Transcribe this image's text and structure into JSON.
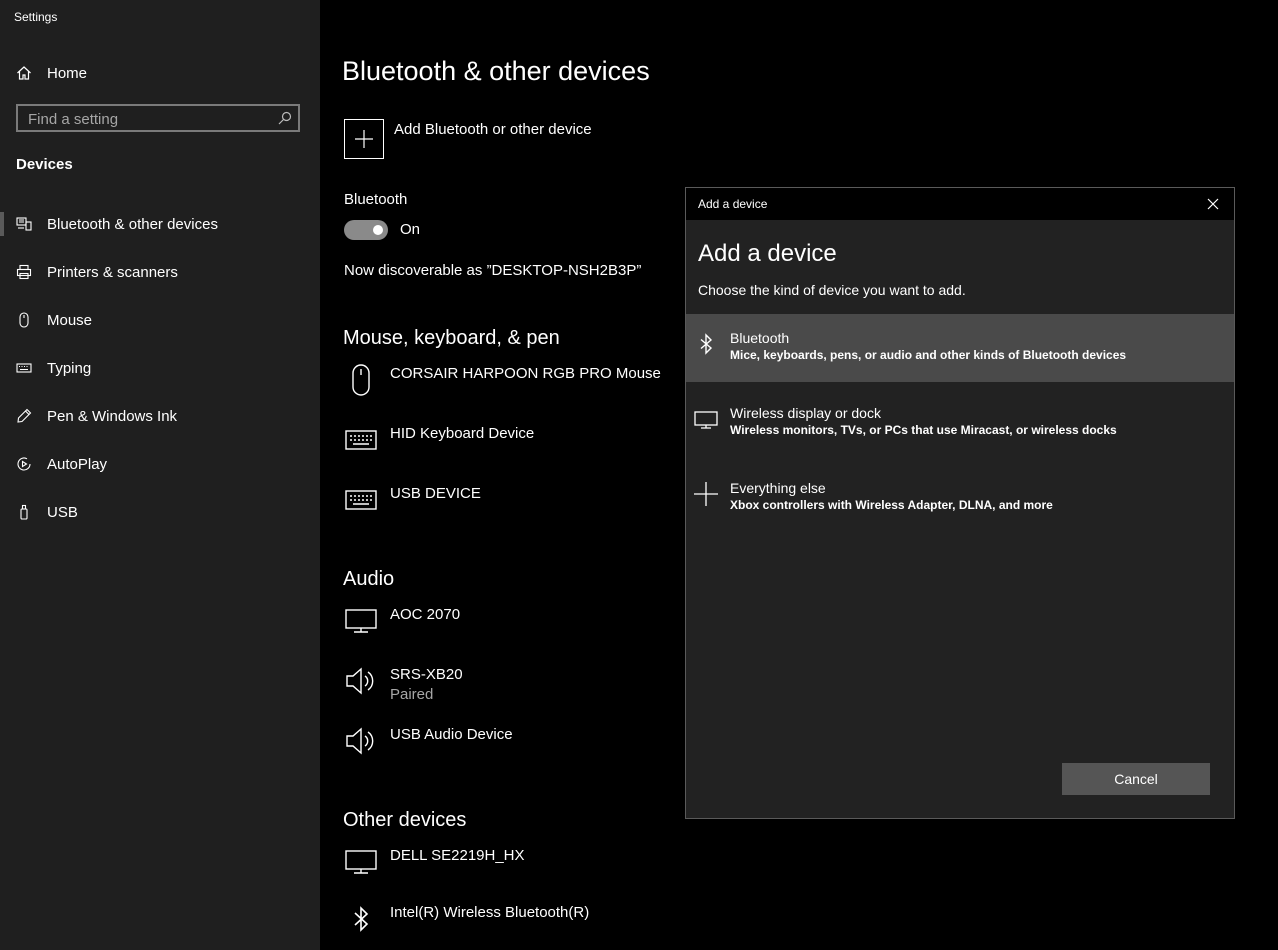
{
  "window": {
    "title": "Settings"
  },
  "sidebar": {
    "home_label": "Home",
    "search_placeholder": "Find a setting",
    "section": "Devices",
    "items": [
      {
        "label": "Bluetooth & other devices",
        "icon": "bluetooth-devices-icon",
        "selected": true
      },
      {
        "label": "Printers & scanners",
        "icon": "printer-icon"
      },
      {
        "label": "Mouse",
        "icon": "mouse-icon"
      },
      {
        "label": "Typing",
        "icon": "keyboard-icon"
      },
      {
        "label": "Pen & Windows Ink",
        "icon": "pen-icon"
      },
      {
        "label": "AutoPlay",
        "icon": "autoplay-icon"
      },
      {
        "label": "USB",
        "icon": "usb-icon"
      }
    ]
  },
  "main": {
    "title": "Bluetooth & other devices",
    "add_label": "Add Bluetooth or other device",
    "bluetooth_label": "Bluetooth",
    "toggle_state": "On",
    "discoverable": "Now discoverable as ”DESKTOP-NSH2B3P”",
    "groups": {
      "mouse": {
        "title": "Mouse, keyboard, & pen",
        "devices": [
          {
            "name": "CORSAIR HARPOON RGB PRO Mouse",
            "icon": "mouse-icon"
          },
          {
            "name": "HID Keyboard Device",
            "icon": "keyboard-icon"
          },
          {
            "name": "USB DEVICE",
            "icon": "keyboard-icon"
          }
        ]
      },
      "audio": {
        "title": "Audio",
        "devices": [
          {
            "name": "AOC 2070",
            "icon": "monitor-icon"
          },
          {
            "name": "SRS-XB20",
            "status": "Paired",
            "icon": "speaker-icon"
          },
          {
            "name": "USB Audio Device",
            "icon": "speaker-icon"
          }
        ]
      },
      "other": {
        "title": "Other devices",
        "devices": [
          {
            "name": "DELL SE2219H_HX",
            "icon": "monitor-icon"
          },
          {
            "name": "Intel(R) Wireless Bluetooth(R)",
            "icon": "bluetooth-icon"
          }
        ]
      }
    }
  },
  "dialog": {
    "titlebar": "Add a device",
    "heading": "Add a device",
    "description": "Choose the kind of device you want to add.",
    "options": [
      {
        "title": "Bluetooth",
        "subtitle": "Mice, keyboards, pens, or audio and other kinds of Bluetooth devices",
        "icon": "bluetooth-icon"
      },
      {
        "title": "Wireless display or dock",
        "subtitle": "Wireless monitors, TVs, or PCs that use Miracast, or wireless docks",
        "icon": "monitor-icon"
      },
      {
        "title": "Everything else",
        "subtitle": "Xbox controllers with Wireless Adapter, DLNA, and more",
        "icon": "plus-icon"
      }
    ],
    "cancel_label": "Cancel"
  }
}
